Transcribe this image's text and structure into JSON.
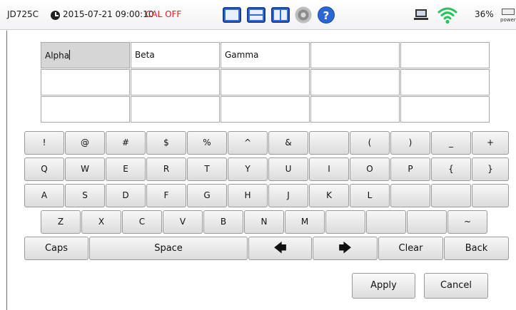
{
  "status_bar": {
    "model": "JD725C",
    "clock_icon": "clock-icon",
    "datetime": "2015-07-21 09:00:10",
    "cal_status": "CAL OFF",
    "cal_status_color": "#e8191f",
    "toolbar_icons": [
      "single-view-icon",
      "dual-view-icon",
      "split-view-icon",
      "settings-gear-icon",
      "help-icon"
    ],
    "help_glyph": "?",
    "connection_icon": "laptop-icon",
    "wifi_icon": "wifi-icon",
    "wifi_color": "#22c55e",
    "battery": "36%",
    "power_label": "power"
  },
  "grid": {
    "rows": [
      [
        "Alpha",
        "Beta",
        "Gamma",
        "",
        ""
      ],
      [
        "",
        "",
        "",
        "",
        ""
      ],
      [
        "",
        "",
        "",
        "",
        ""
      ]
    ],
    "selected_cell": "Alpha"
  },
  "keyboard": {
    "row1": [
      "!",
      "@",
      "#",
      "$",
      "%",
      "^",
      "&",
      "",
      "(",
      ")",
      "_",
      "+"
    ],
    "row2": [
      "Q",
      "W",
      "E",
      "R",
      "T",
      "Y",
      "U",
      "I",
      "O",
      "P",
      "{",
      "}"
    ],
    "row3": [
      "A",
      "S",
      "D",
      "F",
      "G",
      "H",
      "J",
      "K",
      "L",
      "",
      "",
      ""
    ],
    "row4": [
      "Z",
      "X",
      "C",
      "V",
      "B",
      "N",
      "M",
      "",
      "",
      "",
      "~"
    ],
    "caps": "Caps",
    "space": "Space",
    "left_arrow": "🡄",
    "right_arrow": "🡆",
    "clear": "Clear",
    "back": "Back"
  },
  "actions": {
    "apply": "Apply",
    "cancel": "Cancel"
  }
}
